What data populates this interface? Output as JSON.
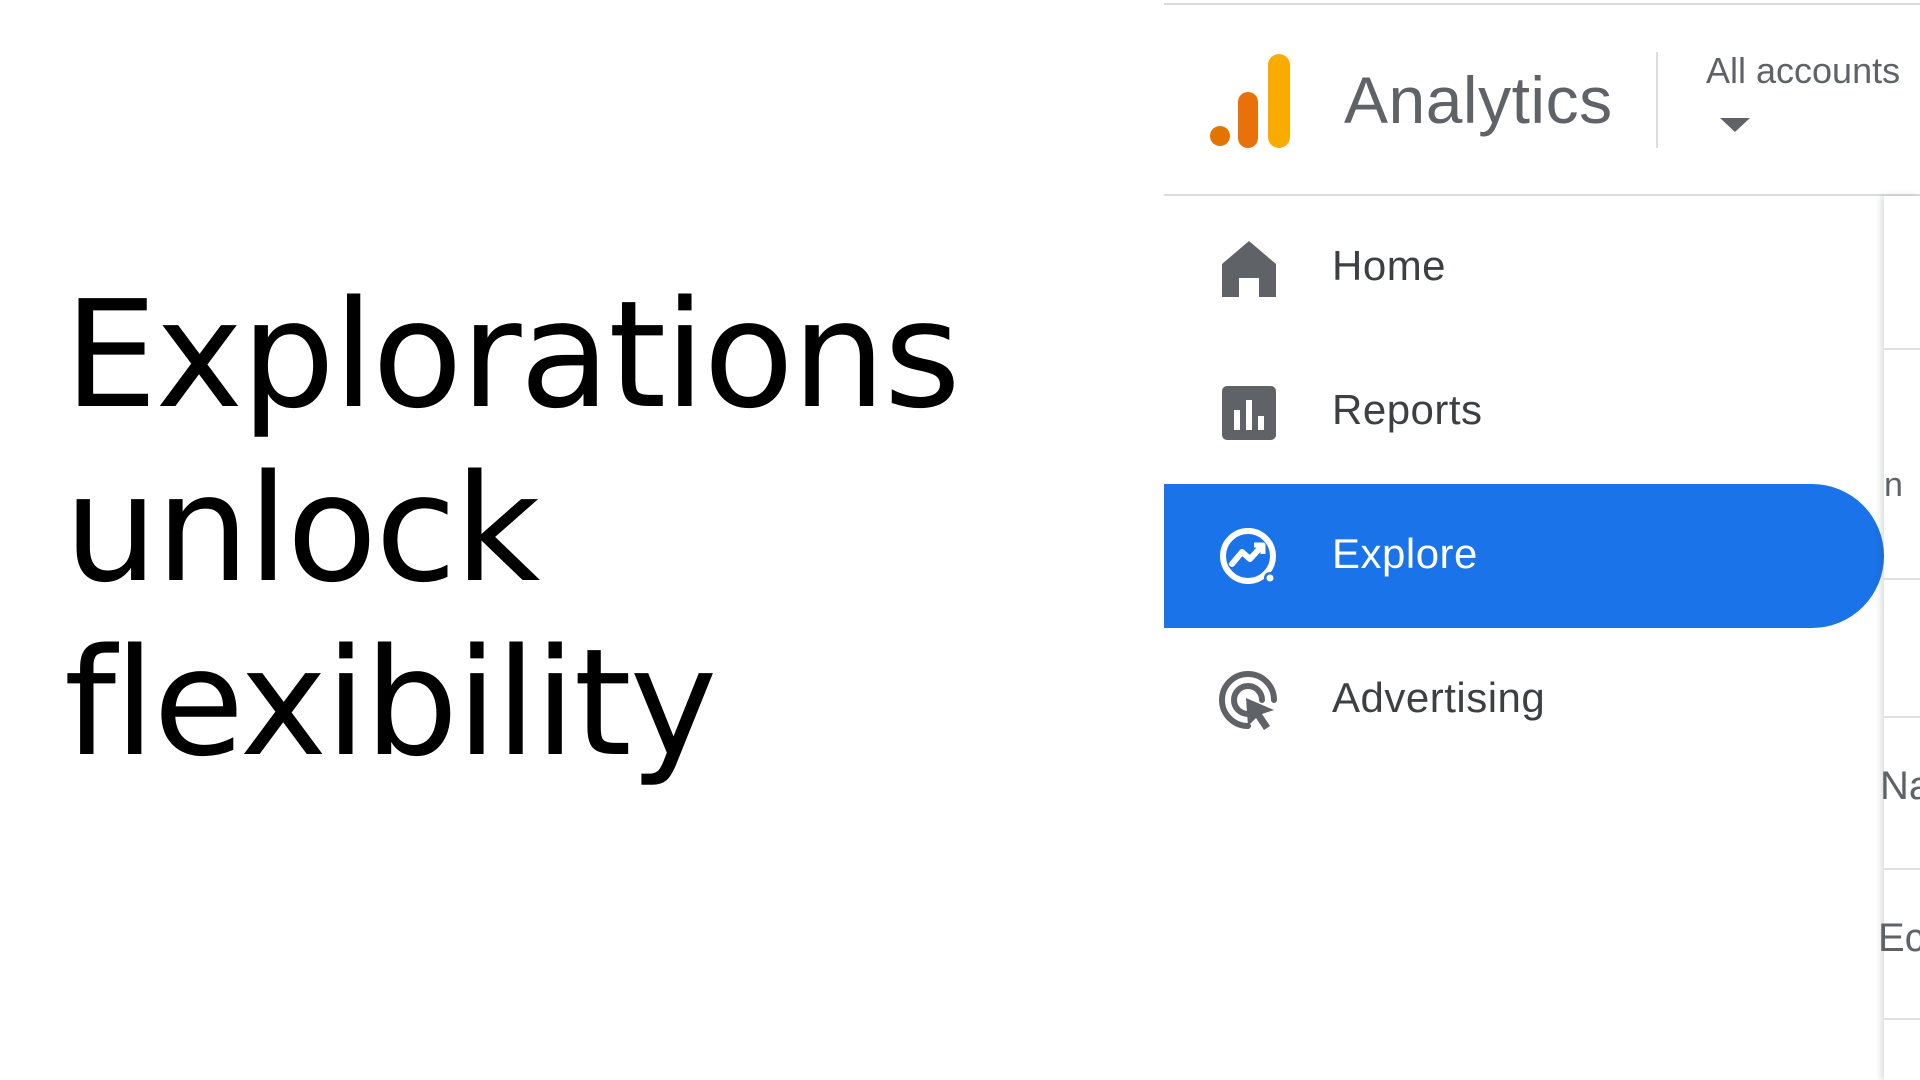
{
  "headline": {
    "line1": "Explorations",
    "line2": "unlock",
    "line3": "flexibility"
  },
  "header": {
    "app_title": "Analytics",
    "account_picker_label": "All accounts",
    "logo_icon": "analytics-bars-icon",
    "caret_icon": "arrow-drop-down-icon"
  },
  "nav": {
    "items": [
      {
        "label": "Home",
        "icon": "home-icon",
        "active": false
      },
      {
        "label": "Reports",
        "icon": "bar-chart-icon",
        "active": false
      },
      {
        "label": "Explore",
        "icon": "explore-trend-icon",
        "active": true
      },
      {
        "label": "Advertising",
        "icon": "ads-click-icon",
        "active": false
      }
    ]
  },
  "side_sheet": {
    "fragments": [
      "n",
      "Na",
      "Ec"
    ]
  },
  "colors": {
    "active_nav_bg": "#1a73e8",
    "logo_orange_dark": "#e8710a",
    "logo_orange": "#f9ab00",
    "text_gray": "#5f6368",
    "icon_gray": "#5f6368"
  }
}
